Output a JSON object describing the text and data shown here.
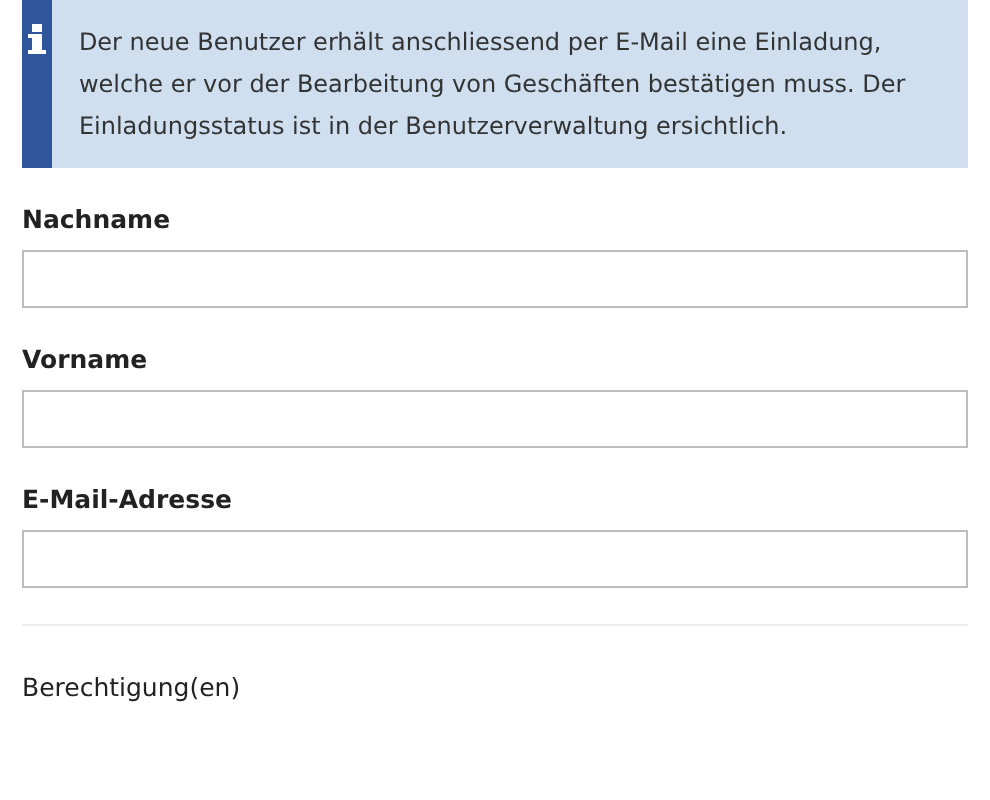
{
  "info": {
    "text": "Der neue Benutzer erhält anschliessend per E-Mail eine Einladung, welche er vor der Bearbeitung von Geschäften bestätigen muss. Der Einladungsstatus ist in der Benutzerverwaltung ersichtlich."
  },
  "fields": [
    {
      "label": "Nachname"
    },
    {
      "label": "Vorname"
    },
    {
      "label": "E-Mail-Adresse"
    }
  ],
  "section": {
    "title": "Berechtigung(en)"
  }
}
